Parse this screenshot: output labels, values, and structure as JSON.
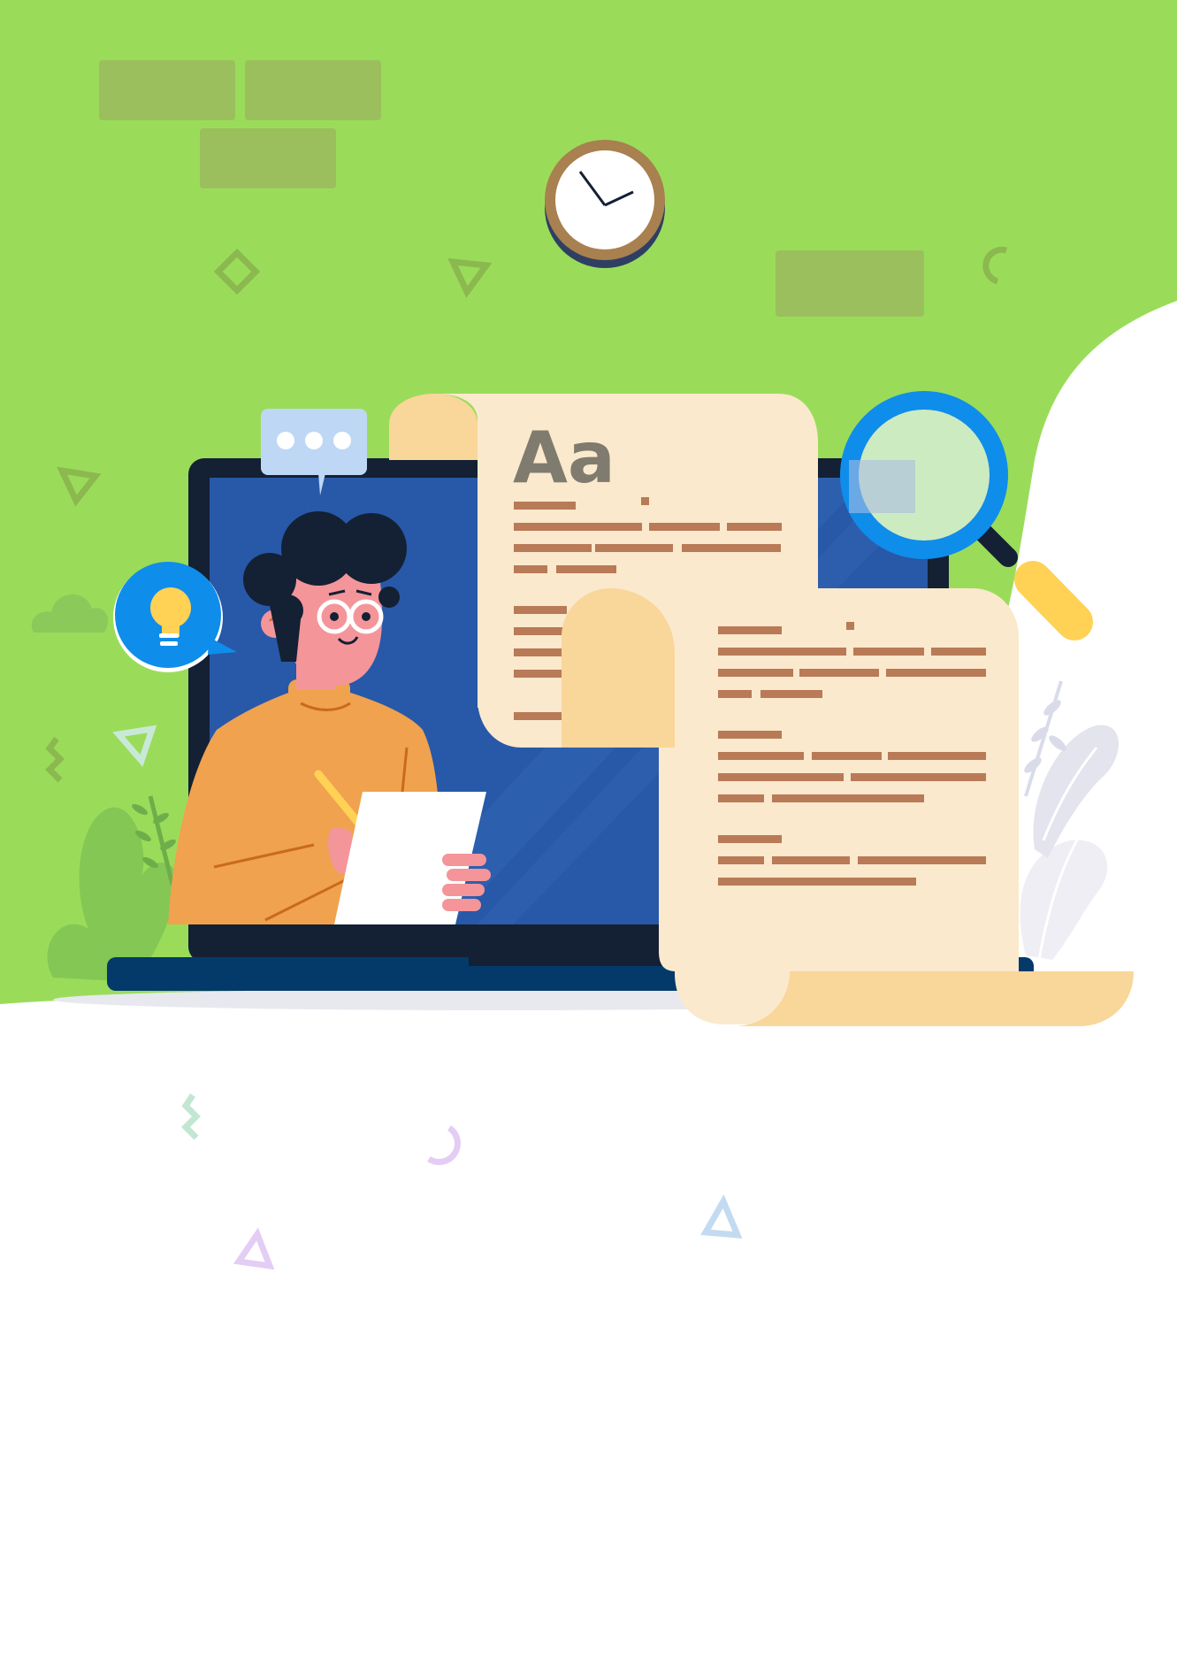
{
  "document_heading": "Aa",
  "colors": {
    "background_green": "#9ADC5A",
    "wall_brick": "#9BBF5C",
    "laptop_frame": "#142033",
    "laptop_screen": "#2858A8",
    "laptop_base": "#033A6A",
    "paper": "#FAE9CC",
    "paper_curl": "#F9D699",
    "text_lines": "#B87A57",
    "sweater": "#F0A24E",
    "skin": "#F4959A",
    "hair": "#142033",
    "magnifier_rim": "#0F8DEB",
    "magnifier_glass": "#CDEBC0",
    "magnifier_handle": "#FFD155",
    "clock_rim": "#A9804F",
    "lightbulb_bubble": "#0F8DEB",
    "lightbulb": "#FFD155",
    "chat_bubble": "#BED7F5"
  },
  "icons": [
    "clock-icon",
    "chat-bubble-icon",
    "lightbulb-icon",
    "magnifier-icon",
    "cloud-icon",
    "leaf-icon"
  ]
}
